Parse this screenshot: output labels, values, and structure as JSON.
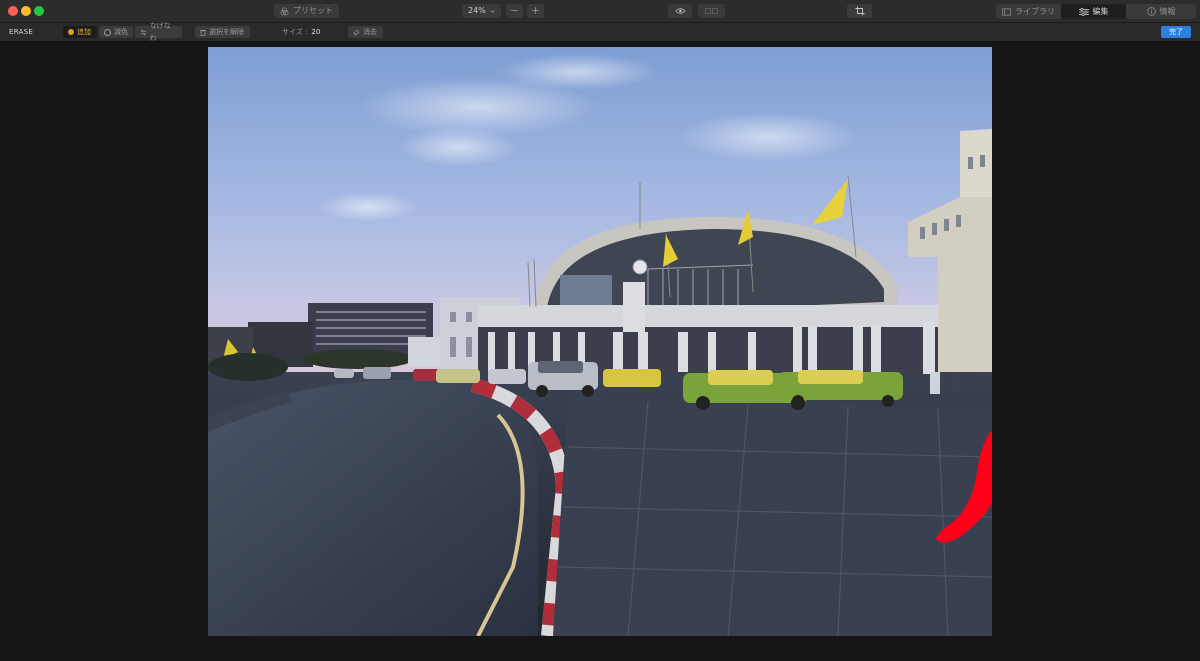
{
  "toolbar": {
    "presets_label": "プリセット",
    "zoom_value": "24%",
    "zoom_out_label": "−",
    "zoom_in_label": "+",
    "compare_label": "□□",
    "tabs": [
      {
        "label": "ライブラリ",
        "icon": "library-icon"
      },
      {
        "label": "編集",
        "icon": "sliders-icon",
        "active": true
      },
      {
        "label": "情報",
        "icon": "info-icon"
      }
    ]
  },
  "erase": {
    "mode_label": "ERASE",
    "add_label": "追加",
    "subtract_label": "減色",
    "smooth_label": "なげなわ",
    "clear_selection_label": "選択を解除",
    "size_label": "サイズ :",
    "size_value": "20",
    "erase_label": "消去",
    "done_label": "完了"
  },
  "colors": {
    "accent": "#2a7fe0",
    "active_tool": "#e0a020",
    "mask_overlay": "#ff0018"
  }
}
